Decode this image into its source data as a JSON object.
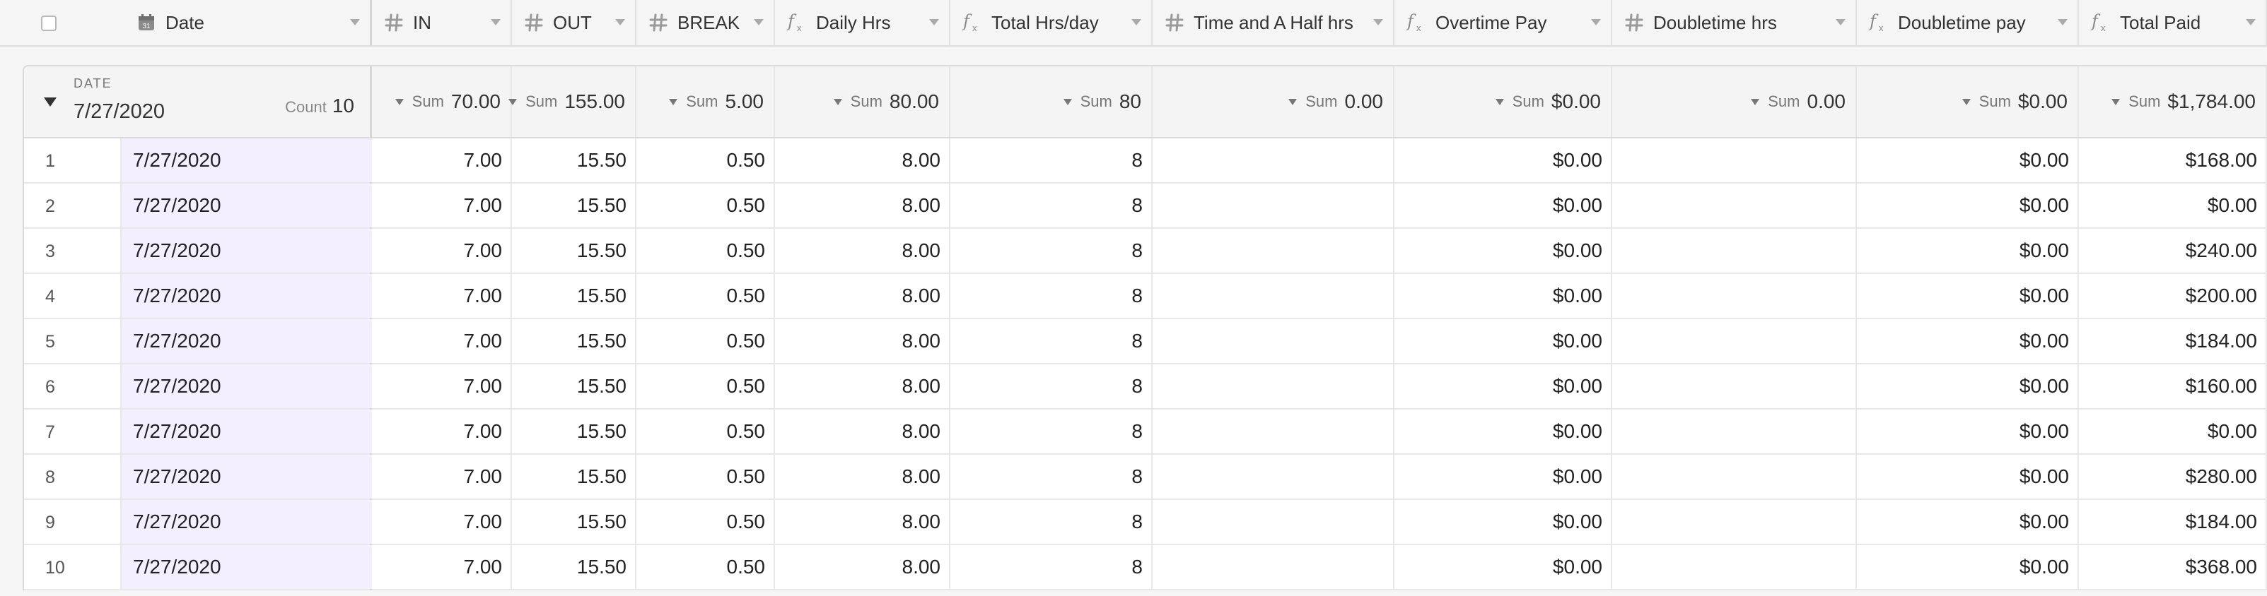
{
  "header": {
    "primary": {
      "name": "Date",
      "icon": "calendar-icon"
    },
    "columns": [
      {
        "key": "in",
        "name": "IN",
        "icon": "number-icon"
      },
      {
        "key": "out",
        "name": "OUT",
        "icon": "number-icon"
      },
      {
        "key": "break",
        "name": "BREAK",
        "icon": "number-icon"
      },
      {
        "key": "daily",
        "name": "Daily Hrs",
        "icon": "formula-icon"
      },
      {
        "key": "total_day",
        "name": "Total Hrs/day",
        "icon": "formula-icon"
      },
      {
        "key": "time_half",
        "name": "Time and A Half hrs",
        "icon": "number-icon"
      },
      {
        "key": "ot_pay",
        "name": "Overtime Pay",
        "icon": "formula-icon"
      },
      {
        "key": "dt_hrs",
        "name": "Doubletime hrs",
        "icon": "number-icon"
      },
      {
        "key": "dt_pay",
        "name": "Doubletime pay",
        "icon": "formula-icon"
      },
      {
        "key": "total_paid",
        "name": "Total Paid",
        "icon": "formula-icon"
      }
    ]
  },
  "group": {
    "field_label": "DATE",
    "value": "7/27/2020",
    "count_label": "Count",
    "count": "10",
    "sum_label": "Sum",
    "sums": [
      "70.00",
      "155.00",
      "5.00",
      "80.00",
      "80",
      "0.00",
      "$0.00",
      "0.00",
      "$0.00",
      "$1,784.00"
    ]
  },
  "rows": [
    {
      "num": "1",
      "date": "7/27/2020",
      "cells": [
        "7.00",
        "15.50",
        "0.50",
        "8.00",
        "8",
        "",
        "$0.00",
        "",
        "$0.00",
        "$168.00"
      ]
    },
    {
      "num": "2",
      "date": "7/27/2020",
      "cells": [
        "7.00",
        "15.50",
        "0.50",
        "8.00",
        "8",
        "",
        "$0.00",
        "",
        "$0.00",
        "$0.00"
      ]
    },
    {
      "num": "3",
      "date": "7/27/2020",
      "cells": [
        "7.00",
        "15.50",
        "0.50",
        "8.00",
        "8",
        "",
        "$0.00",
        "",
        "$0.00",
        "$240.00"
      ]
    },
    {
      "num": "4",
      "date": "7/27/2020",
      "cells": [
        "7.00",
        "15.50",
        "0.50",
        "8.00",
        "8",
        "",
        "$0.00",
        "",
        "$0.00",
        "$200.00"
      ]
    },
    {
      "num": "5",
      "date": "7/27/2020",
      "cells": [
        "7.00",
        "15.50",
        "0.50",
        "8.00",
        "8",
        "",
        "$0.00",
        "",
        "$0.00",
        "$184.00"
      ]
    },
    {
      "num": "6",
      "date": "7/27/2020",
      "cells": [
        "7.00",
        "15.50",
        "0.50",
        "8.00",
        "8",
        "",
        "$0.00",
        "",
        "$0.00",
        "$160.00"
      ]
    },
    {
      "num": "7",
      "date": "7/27/2020",
      "cells": [
        "7.00",
        "15.50",
        "0.50",
        "8.00",
        "8",
        "",
        "$0.00",
        "",
        "$0.00",
        "$0.00"
      ]
    },
    {
      "num": "8",
      "date": "7/27/2020",
      "cells": [
        "7.00",
        "15.50",
        "0.50",
        "8.00",
        "8",
        "",
        "$0.00",
        "",
        "$0.00",
        "$280.00"
      ]
    },
    {
      "num": "9",
      "date": "7/27/2020",
      "cells": [
        "7.00",
        "15.50",
        "0.50",
        "8.00",
        "8",
        "",
        "$0.00",
        "",
        "$0.00",
        "$184.00"
      ]
    },
    {
      "num": "10",
      "date": "7/27/2020",
      "cells": [
        "7.00",
        "15.50",
        "0.50",
        "8.00",
        "8",
        "",
        "$0.00",
        "",
        "$0.00",
        "$368.00"
      ]
    }
  ],
  "colors": {
    "date_cell_bg": "#f3efff",
    "header_bg": "#f5f5f5"
  }
}
